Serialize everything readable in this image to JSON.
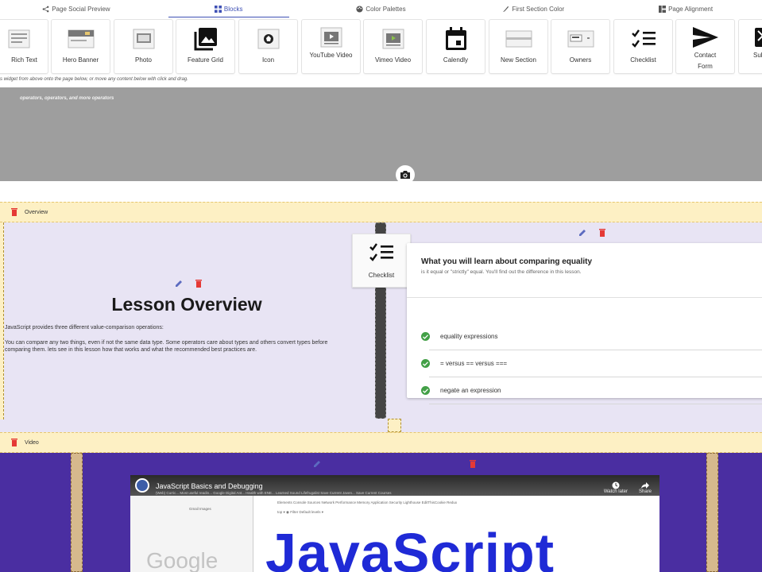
{
  "tabs": [
    {
      "label": "Page Social Preview",
      "icon": "share-icon"
    },
    {
      "label": "Blocks",
      "icon": "grid-icon",
      "active": true
    },
    {
      "label": "Color Palettes",
      "icon": "palette-icon"
    },
    {
      "label": "First Section Color",
      "icon": "brush-icon"
    },
    {
      "label": "Page Alignment",
      "icon": "alignment-icon"
    }
  ],
  "blocks": [
    {
      "label": "Rich Text",
      "icon": "rich-text-icon"
    },
    {
      "label": "Hero Banner",
      "icon": "hero-banner-icon"
    },
    {
      "label": "Photo",
      "icon": "photo-icon"
    },
    {
      "label": "Feature Grid",
      "icon": "feature-grid-icon"
    },
    {
      "label": "Icon",
      "icon": "icon-block-icon"
    },
    {
      "label": "YouTube Video",
      "icon": "youtube-icon"
    },
    {
      "label": "Vimeo Video",
      "icon": "vimeo-icon"
    },
    {
      "label": "Calendly",
      "icon": "calendar-icon"
    },
    {
      "label": "New Section",
      "icon": "new-section-icon"
    },
    {
      "label": "Owners",
      "icon": "owners-icon"
    },
    {
      "label": "Checklist",
      "icon": "checklist-icon"
    },
    {
      "label": "Contact Form",
      "icon": "send-icon"
    },
    {
      "label": "Sub",
      "icon": "subscribe-icon"
    }
  ],
  "palette_hint": "s widget from above onto the page below, or move any content below with click and drag.",
  "hero": {
    "subtitle": "operators, operators, and more operators"
  },
  "sections": {
    "overview_label": "Overview",
    "video_label": "Video"
  },
  "lesson": {
    "title": "Lesson Overview",
    "p1": "JavaScript provides three different value-comparison operations:",
    "p2": "You can compare any two things, even if not the same data type. Some operators care about types and others convert types before comparing them. lets see in this lesson how that works and what the recommended best practices are."
  },
  "drag_ghost": {
    "label": "Checklist"
  },
  "checklist": {
    "title": "What you will learn about comparing equality",
    "subtitle": "is it equal or \"strictly\" equal. You'll find out the difference in this lesson.",
    "items": [
      "equality expressions",
      "= versus == versus ===",
      "negate an expression"
    ]
  },
  "video": {
    "title": "JavaScript Basics and Debugging",
    "watch_later": "Watch later",
    "share": "Share",
    "bookmarks": "(Web) Curric...   Most useful readin...   Google Digital Ant...   Health with ENE...   Learned   Sound   Lifefrugalist   Save Current Javen...   Save Current Courses",
    "devtools_tabs": "Elements   Console   Sources   Network   Performance   Memory   Application   Security   Lighthouse   EditThisCookie   Redux",
    "filter": "top     ▾  ◉   Filter                                    Default levels ▾",
    "left_links": "Gmail   Images",
    "google_word": "Google",
    "overlay_word": "JavaScript"
  },
  "colors": {
    "accent": "#3f51b5",
    "hero_bg": "#9e9e9e",
    "section_bar": "#fdf0c4",
    "overview_bg": "#e8e4f4",
    "video_bg": "#4a2ea1",
    "check_green": "#43a047",
    "delete_red": "#e53935",
    "edit_blue": "#5c6bc0"
  }
}
